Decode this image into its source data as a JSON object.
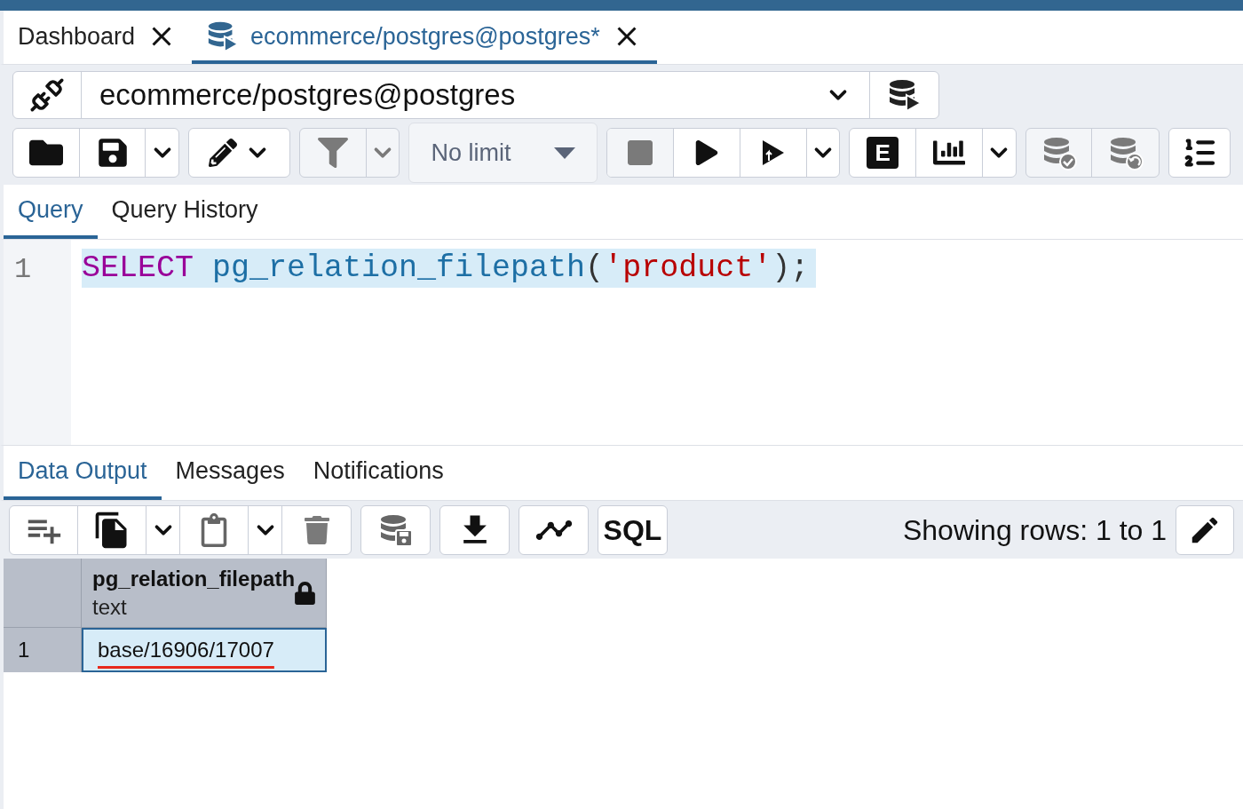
{
  "tabs": [
    {
      "label": "Dashboard",
      "kind": "dashboard",
      "selected": false
    },
    {
      "label": "ecommerce/postgres@postgres*",
      "kind": "query",
      "selected": true
    }
  ],
  "connection": {
    "value": "ecommerce/postgres@postgres"
  },
  "toolbar": {
    "limit": "No limit",
    "explain_label": "E"
  },
  "editor_tabs": [
    {
      "label": "Query",
      "selected": true
    },
    {
      "label": "Query History",
      "selected": false
    }
  ],
  "editor": {
    "lines": [
      {
        "number": "1",
        "highlighted": true,
        "tokens": [
          {
            "text": "SELECT",
            "kind": "keyword"
          },
          {
            "text": "pg_relation_filepath",
            "kind": "function"
          },
          {
            "text": "(",
            "kind": "punct"
          },
          {
            "text": "'product'",
            "kind": "string"
          },
          {
            "text": ");",
            "kind": "punct"
          }
        ]
      }
    ]
  },
  "output_tabs": [
    {
      "label": "Data Output",
      "selected": true
    },
    {
      "label": "Messages",
      "selected": false
    },
    {
      "label": "Notifications",
      "selected": false
    }
  ],
  "output_toolbar": {
    "sql_label": "SQL",
    "status": "Showing rows: 1 to 1"
  },
  "grid": {
    "columns": [
      {
        "name": "pg_relation_filepath",
        "type": "text",
        "locked": true
      }
    ],
    "rows": [
      {
        "number": "1",
        "selected": true,
        "underlined": true,
        "cells": [
          "base/16906/17007"
        ]
      }
    ]
  }
}
